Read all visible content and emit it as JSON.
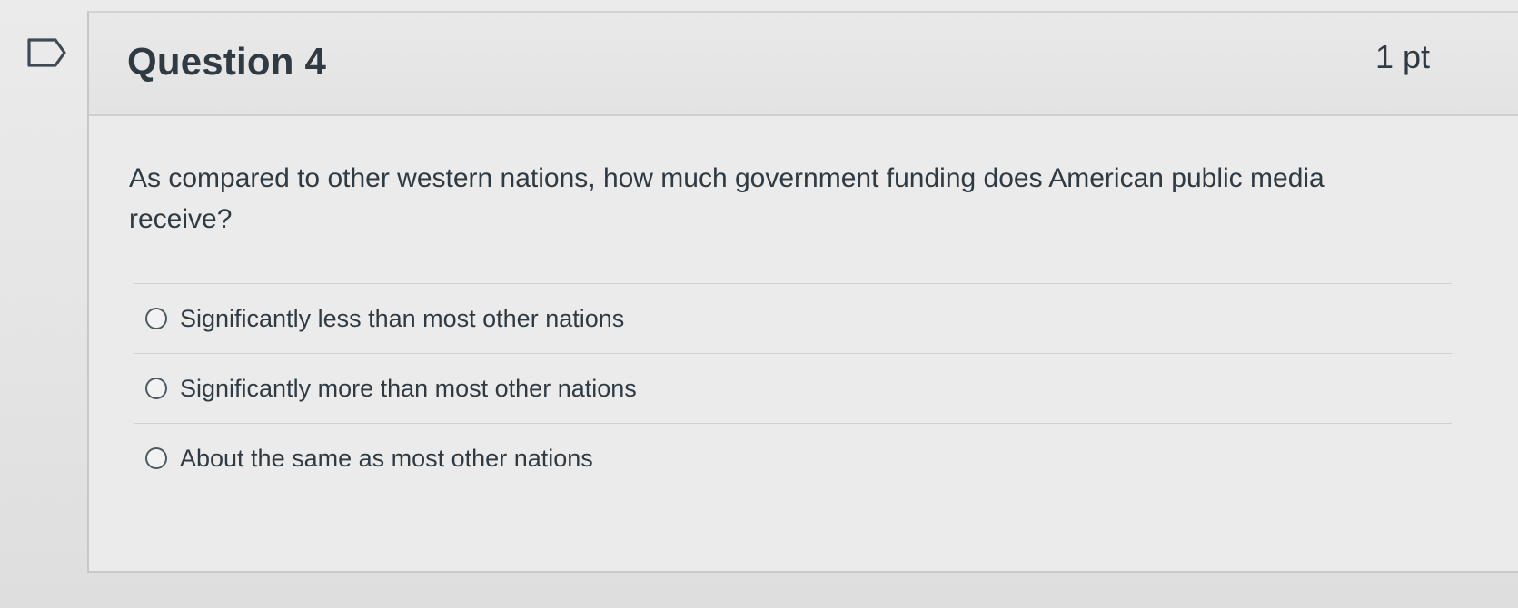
{
  "question": {
    "title": "Question 4",
    "points": "1 pt",
    "prompt": "As compared to other western nations, how much government funding does American public media receive?",
    "answers": [
      {
        "label": "Significantly less than most other nations"
      },
      {
        "label": "Significantly more than most other nations"
      },
      {
        "label": "About the same as most other nations"
      }
    ]
  },
  "icons": {
    "flag": "flag-question-icon",
    "radio": "radio-button-icon"
  },
  "colors": {
    "background": "#e6e6e6",
    "text": "#2f3a43",
    "border": "#cfcfcf"
  }
}
